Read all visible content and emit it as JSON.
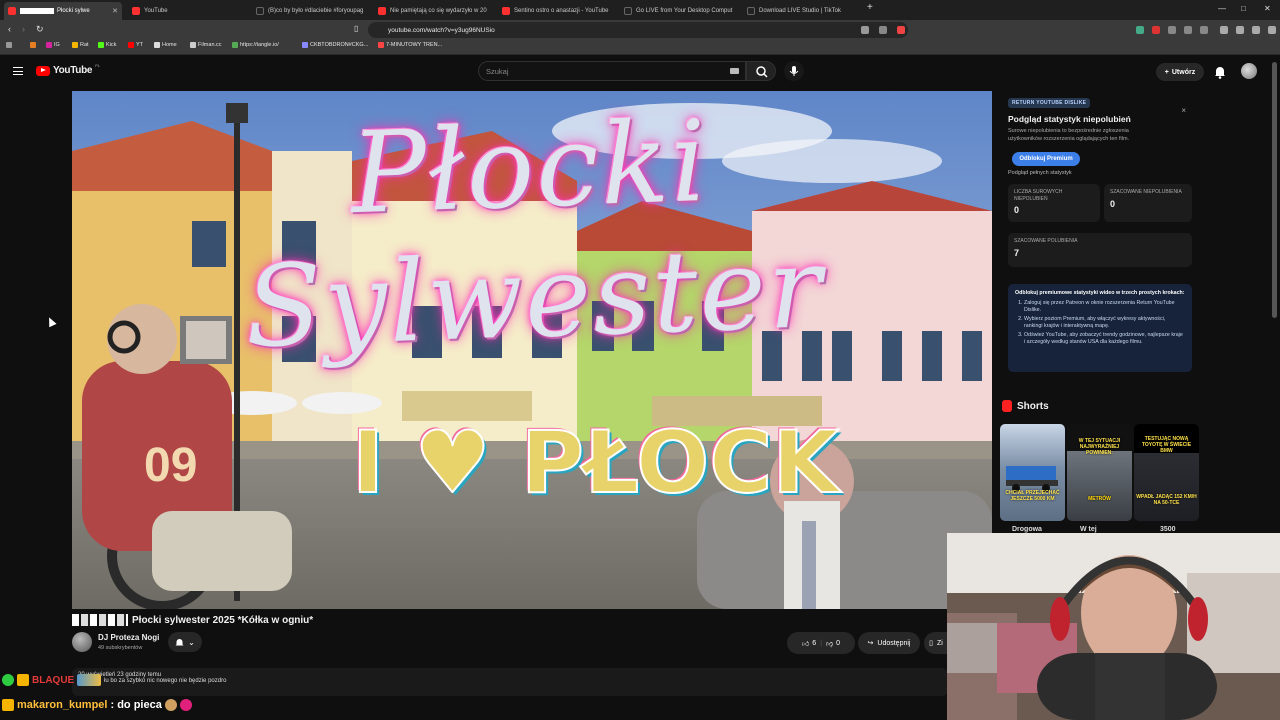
{
  "browser": {
    "tabs": [
      {
        "label": "Płocki sylwe",
        "active": true,
        "favicon_color": "#ff3030"
      },
      {
        "label": "YouTube",
        "favicon_color": "#ff3030"
      },
      {
        "label": "(B)co by było #dlaciebie #foryoupag",
        "favicon_color": "#222222"
      },
      {
        "label": "Nie pamiętają co się wydarzyło w 20",
        "favicon_color": "#ff3030"
      },
      {
        "label": "Sentino ostro o anastazji - YouTube",
        "favicon_color": "#ff3030"
      },
      {
        "label": "Go LIVE from Your Desktop Comput",
        "favicon_color": "#222222"
      },
      {
        "label": "Download LIVE Studio | TikTok",
        "favicon_color": "#222222"
      }
    ],
    "new_tab": "+",
    "window_controls": [
      "—",
      "□",
      "✕"
    ],
    "url": "youtube.com/watch?v=y3ug96NUSio",
    "bookmarks": [
      {
        "label": "IG",
        "color": "#d6249f"
      },
      {
        "label": "Rat",
        "color": "#f4b400"
      },
      {
        "label": "Kick",
        "color": "#53fc18"
      },
      {
        "label": "YT",
        "color": "#ff0000"
      },
      {
        "label": "Home",
        "color": "#dddddd"
      },
      {
        "label": "Filman.cc",
        "color": "#cccccc"
      },
      {
        "label": "https://tangle.io/",
        "color": "#55aa55"
      },
      {
        "label": "CKBTOBDRON#CKG...",
        "color": "#8888ff"
      },
      {
        "label": "7-MINUTOWY TREN...",
        "color": "#ff4444"
      }
    ]
  },
  "youtube": {
    "logo_text": "YouTube",
    "country_code": "PL",
    "search_placeholder": "Szukaj",
    "create_label": "Utwórz",
    "video": {
      "overlay_title": "Płocki Sylwester",
      "ilove_text": "I ♥ PŁOCK",
      "title": "Płocki sylwester 2025 *Kółka w ogniu*",
      "channel": "DJ Proteza Nogi",
      "subscribers": "49 subskrybentów",
      "likes": "6",
      "dislikes": "0",
      "share_label": "Udostępnij",
      "more_label": "Zi",
      "views_line": "20 wyświetleń  23 godziny temu",
      "desc_line": "łu bo za szybko nic nowego nie będzie pozdro"
    },
    "ryd": {
      "tag": "RETURN YOUTUBE DISLIKE",
      "close": "×",
      "title": "Podgląd statystyk niepolubień",
      "desc": "Surowe niepolubienia to bezpośrednie zgłoszenia użytkowników rozszerzenia oglądających ten film.",
      "button": "Odblokuj Premium",
      "link": "Podgląd pełnych statystyk",
      "stats": [
        {
          "label": "LICZBA SUROWYCH NIEPOLUBIEŃ",
          "value": "0"
        },
        {
          "label": "SZACOWANE NIEPOLUBIENIA",
          "value": "0"
        },
        {
          "label": "SZACOWANE POLUBIENIA",
          "value": "7"
        }
      ],
      "premium_head": "Odblokuj premiumowe statystyki wideo w trzech prostych krokach:",
      "premium_steps": [
        "Zaloguj się przez Patreon w oknie rozszerzenia Return YouTube Dislike.",
        "Wybierz poziom Premium, aby włączyć wykresy aktywności, rankingi krajów i interaktywną mapę.",
        "Odśwież YouTube, aby zobaczyć trendy godzinowe, najlepsze kraje i szczegóły według stanów USA dla każdego filmu."
      ]
    },
    "shorts": {
      "heading": "Shorts",
      "items": [
        {
          "caption": "CHCIAŁ PRZEJECHAĆ JESZCZE 5000 KM",
          "label": "Drogowa",
          "bg": "#7b8fa6"
        },
        {
          "caption": "W TEJ SYTUACJI NAJWYRAŹNIEJ POWINIEN:",
          "caption2": "METRÓW",
          "label": "W tej",
          "bg": "#3a3e44"
        },
        {
          "caption": "TESTUJĄC NOWĄ TOYOTĘ W ŚWIECIE BMW",
          "caption2": "WPADŁ JADĄC 152 KM/H NA 50-TCE",
          "label": "3500",
          "bg": "#1e1f24"
        }
      ]
    }
  },
  "chat": {
    "line1_user": "BLAQUE",
    "line2_user": "makaron_kumpel",
    "line2_text": ": do pieca"
  }
}
